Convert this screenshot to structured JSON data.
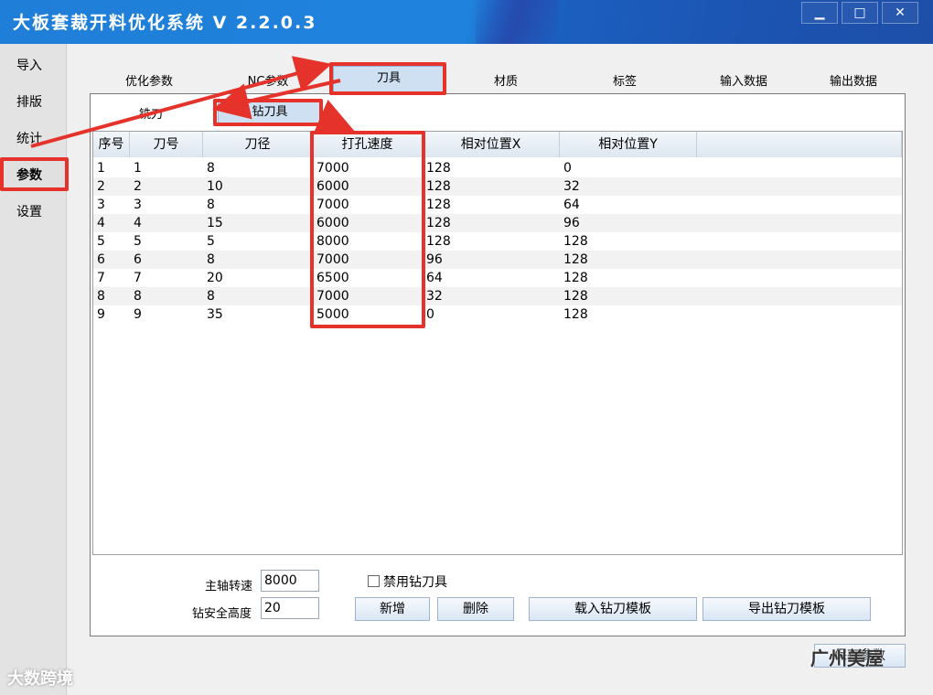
{
  "window": {
    "title": "大板套裁开料优化系统 V 2.2.0.3",
    "minimize_label": "▁",
    "maximize_label": "□",
    "close_label": "✕"
  },
  "nav": {
    "items": [
      {
        "label": "导入"
      },
      {
        "label": "排版"
      },
      {
        "label": "统计"
      },
      {
        "label": "参数"
      },
      {
        "label": "设置"
      }
    ],
    "active": "参数"
  },
  "tabs": [
    {
      "label": "优化参数"
    },
    {
      "label": "NC参数"
    },
    {
      "label": "刀具"
    },
    {
      "label": "材质"
    },
    {
      "label": "标签"
    },
    {
      "label": "输入数据"
    },
    {
      "label": "输出数据"
    }
  ],
  "selected_tab": "刀具",
  "subtabs": [
    {
      "label": "铣刀"
    },
    {
      "label": "钻刀具"
    }
  ],
  "selected_subtab": "钻刀具",
  "table": {
    "columns": [
      "序号",
      "刀号",
      "刀径",
      "打孔速度",
      "相对位置X",
      "相对位置Y"
    ],
    "rows": [
      [
        "1",
        "1",
        "8",
        "7000",
        "128",
        "0"
      ],
      [
        "2",
        "2",
        "10",
        "6000",
        "128",
        "32"
      ],
      [
        "3",
        "3",
        "8",
        "7000",
        "128",
        "64"
      ],
      [
        "4",
        "4",
        "15",
        "6000",
        "128",
        "96"
      ],
      [
        "5",
        "5",
        "5",
        "8000",
        "128",
        "128"
      ],
      [
        "6",
        "6",
        "8",
        "7000",
        "96",
        "128"
      ],
      [
        "7",
        "7",
        "20",
        "6500",
        "64",
        "128"
      ],
      [
        "8",
        "8",
        "8",
        "7000",
        "32",
        "128"
      ],
      [
        "9",
        "9",
        "35",
        "5000",
        "0",
        "128"
      ]
    ]
  },
  "form": {
    "spindle_speed_label": "主轴转速",
    "spindle_speed_value": "8000",
    "drill_safe_height_label": "钻安全高度",
    "drill_safe_height_value": "20",
    "disable_drill_label": "禁用钻刀具",
    "disable_drill_checked": false
  },
  "buttons": {
    "add": "新增",
    "delete": "删除",
    "load_template": "载入钻刀模板",
    "export_template": "导出钻刀模板",
    "save": "保存参数"
  },
  "watermark": {
    "left": "大数跨境",
    "right": "广州美屋"
  },
  "colors": {
    "titlebar": "#1f7ed8",
    "highlight": "#e5322a",
    "selected_tab": "#cfe0f2"
  }
}
